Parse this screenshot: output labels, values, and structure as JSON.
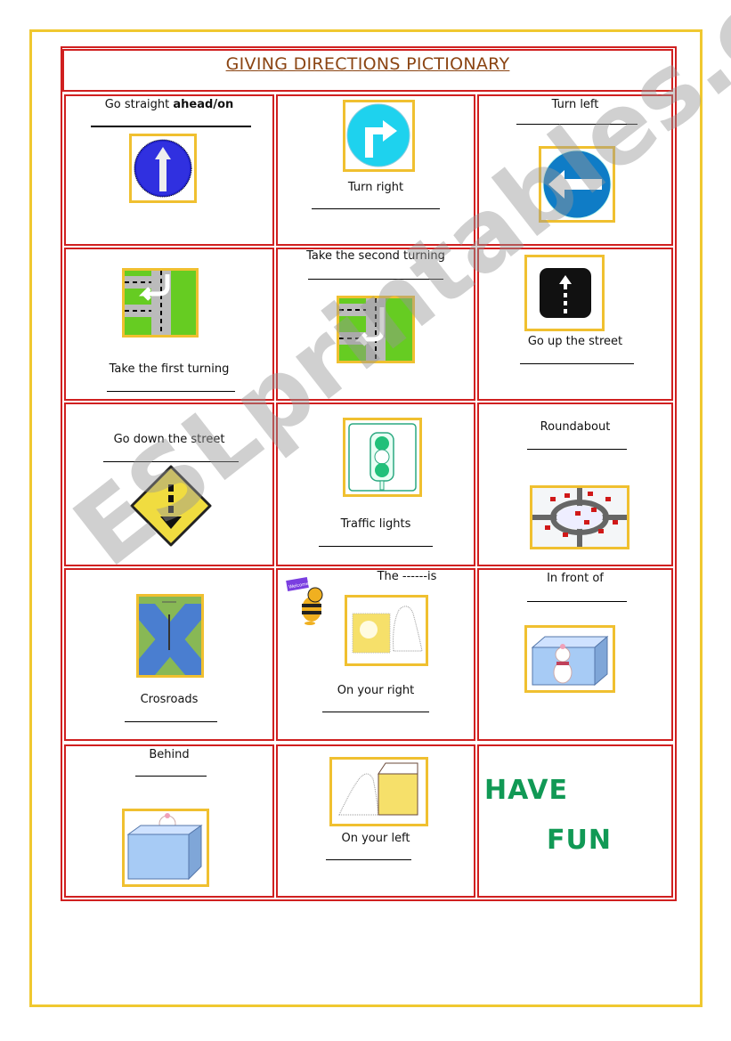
{
  "title": "GIVING DIRECTIONS PICTIONARY",
  "watermark": "ESLprintables.com",
  "cells": {
    "go_straight": {
      "label_plain": "Go straight ",
      "label_bold": "ahead/on",
      "icon": "one-way-up-arrow-sign"
    },
    "turn_right": {
      "label": "Turn right",
      "icon": "turn-right-sign"
    },
    "turn_left": {
      "label": "Turn left",
      "icon": "turn-left-sign"
    },
    "first_turning": {
      "label": "Take the first turning",
      "icon": "first-turning-map"
    },
    "second_turning": {
      "label": "Take the second turning",
      "icon": "second-turning-map"
    },
    "go_up": {
      "label": "Go up the street",
      "icon": "up-arrow-button"
    },
    "go_down": {
      "label": "Go down the street",
      "icon": "down-arrow-diamond-sign"
    },
    "traffic_lights": {
      "label": "Traffic lights",
      "icon": "traffic-light"
    },
    "roundabout": {
      "label": "Roundabout",
      "icon": "roundabout-illustration"
    },
    "crossroads": {
      "label": "Crosroads",
      "icon": "crossroads-aerial"
    },
    "on_right": {
      "header": "The ------is",
      "bee_sign": "Welcome",
      "label": "On your right",
      "icon": "ghost-right-of-box"
    },
    "in_front": {
      "label": "In front of",
      "icon": "cat-in-front-of-box"
    },
    "behind": {
      "label": "Behind",
      "icon": "cat-behind-box"
    },
    "on_left": {
      "label": "On your left",
      "icon": "ghost-left-of-box"
    },
    "have_fun": {
      "line1": "HAVE",
      "line2": "FUN"
    }
  },
  "colors": {
    "frame": "#f0c830",
    "table_border": "#d02020",
    "title": "#8b4513",
    "fun": "#119955"
  }
}
